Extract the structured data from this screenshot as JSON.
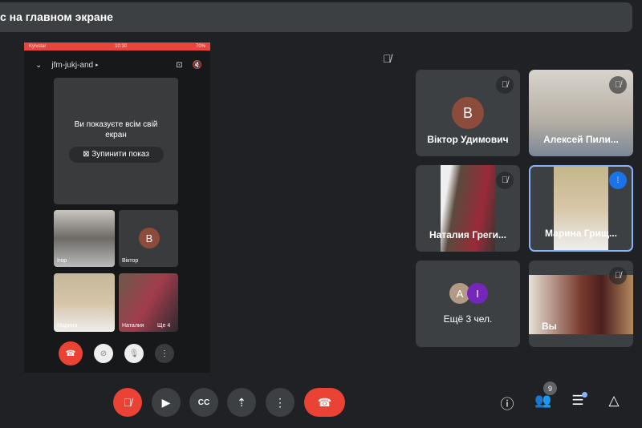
{
  "banner": {
    "text": "с на главном экране"
  },
  "phone": {
    "status": {
      "carrier": "Kyivstar",
      "time": "10:30",
      "battery": "70%"
    },
    "meeting_code": "jfm-jukj-and",
    "presenting": {
      "message": "Ви показуєте всім свій екран",
      "stop_label": "Зупинити показ"
    },
    "participants": [
      {
        "name": "Ігор"
      },
      {
        "name": "Віктор",
        "initial": "B"
      },
      {
        "name": "Марина"
      },
      {
        "name": "Наталия",
        "more": "Ще 4"
      }
    ]
  },
  "tiles": [
    {
      "name": "Віктор Удимович",
      "initial": "B",
      "muted": true
    },
    {
      "name": "Алексей Пили...",
      "muted": true
    },
    {
      "name": "Наталия Греги...",
      "muted": true
    },
    {
      "name": "Марина Грищ...",
      "speaking": true
    },
    {
      "name": "Ещё 3 чел.",
      "initials": [
        "A",
        "I"
      ]
    },
    {
      "name": "Вы",
      "muted": true
    }
  ],
  "toolbar": {
    "people_count": "9"
  },
  "colors": {
    "red": "#ea4335",
    "blue": "#8ab4f8",
    "tile": "#3c4043"
  }
}
